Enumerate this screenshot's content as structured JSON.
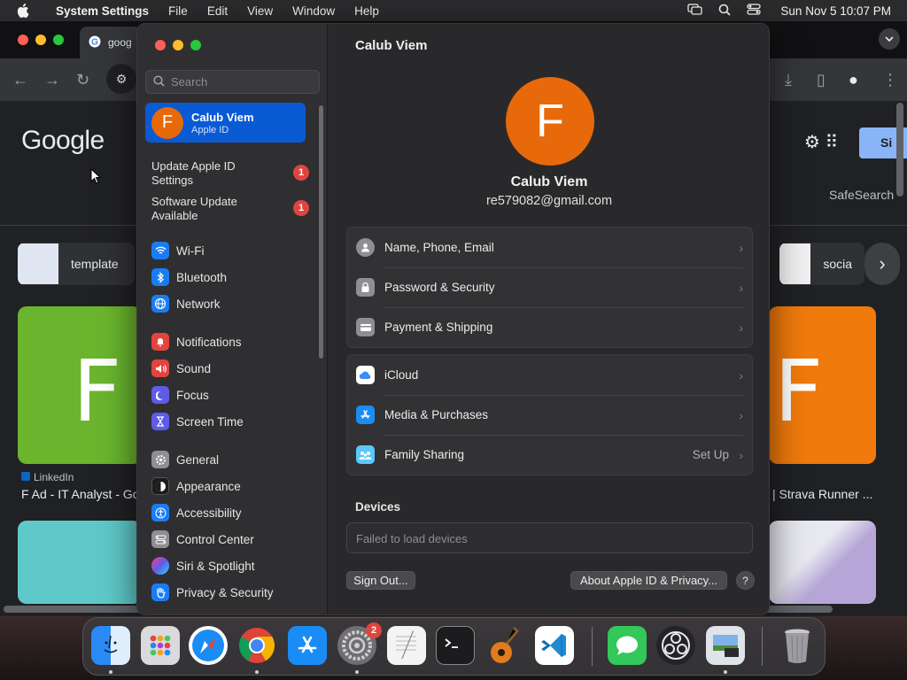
{
  "menubar": {
    "app_name": "System Settings",
    "items": [
      "File",
      "Edit",
      "View",
      "Window",
      "Help"
    ],
    "clock": "Sun Nov 5  10:07 PM"
  },
  "browser": {
    "tab_title": "goog",
    "google_logo": "Google",
    "signin_label": "Si",
    "safesearch": "SafeSearch",
    "chips": [
      {
        "label": "template"
      },
      {
        "label": "socia"
      }
    ],
    "cards": [
      {
        "letter": "F",
        "source": "LinkedIn",
        "caption": "F Ad - IT Analyst - Go",
        "color": "#6ab52d"
      },
      {
        "letter": "F",
        "caption": "| Strava Runner ...",
        "color": "#f07a0c"
      }
    ]
  },
  "settings": {
    "search_placeholder": "Search",
    "account": {
      "initial": "F",
      "name": "Calub Viem",
      "sub": "Apple ID"
    },
    "notices": [
      {
        "label": "Update Apple ID Settings",
        "badge": "1"
      },
      {
        "label": "Software Update Available",
        "badge": "1"
      }
    ],
    "sidebar_items": [
      {
        "label": "Wi-Fi",
        "icon": "wifi-icon",
        "color": "#1a7cf5"
      },
      {
        "label": "Bluetooth",
        "icon": "bluetooth-icon",
        "color": "#1a7cf5"
      },
      {
        "label": "Network",
        "icon": "globe-icon",
        "color": "#1a7cf5"
      },
      {
        "label": "Notifications",
        "icon": "bell-icon",
        "color": "#e5443d"
      },
      {
        "label": "Sound",
        "icon": "speaker-icon",
        "color": "#e5443d"
      },
      {
        "label": "Focus",
        "icon": "moon-icon",
        "color": "#5e5ce6"
      },
      {
        "label": "Screen Time",
        "icon": "hourglass-icon",
        "color": "#5e5ce6"
      },
      {
        "label": "General",
        "icon": "gear-icon",
        "color": "#8e8e93"
      },
      {
        "label": "Appearance",
        "icon": "appearance-icon",
        "color": "#1c1c1e"
      },
      {
        "label": "Accessibility",
        "icon": "accessibility-icon",
        "color": "#1a7cf5"
      },
      {
        "label": "Control Center",
        "icon": "control-center-icon",
        "color": "#8e8e93"
      },
      {
        "label": "Siri & Spotlight",
        "icon": "siri-icon",
        "color": "#b03cd8"
      },
      {
        "label": "Privacy & Security",
        "icon": "hand-icon",
        "color": "#1a7cf5"
      }
    ],
    "main": {
      "title": "Calub Viem",
      "avatar_initial": "F",
      "full_name": "Calub Viem",
      "email": "re579082@gmail.com",
      "group1": [
        {
          "label": "Name, Phone, Email",
          "icon": "person-icon"
        },
        {
          "label": "Password & Security",
          "icon": "lock-icon"
        },
        {
          "label": "Payment & Shipping",
          "icon": "card-icon"
        }
      ],
      "group2": [
        {
          "label": "iCloud",
          "icon": "cloud-icon",
          "value": ""
        },
        {
          "label": "Media & Purchases",
          "icon": "app-store-icon",
          "value": ""
        },
        {
          "label": "Family Sharing",
          "icon": "family-icon",
          "value": "Set Up"
        }
      ],
      "devices_heading": "Devices",
      "devices_message": "Failed to load devices",
      "sign_out": "Sign Out...",
      "about": "About Apple ID & Privacy...",
      "help": "?"
    }
  },
  "dock": {
    "settings_badge": "2",
    "apps": [
      "Finder",
      "Launchpad",
      "Safari",
      "Chrome",
      "App Store",
      "System Settings",
      "TextEdit",
      "Terminal",
      "GarageBand",
      "VS Code",
      "Messages",
      "OBS",
      "Preview",
      "Trash"
    ]
  }
}
